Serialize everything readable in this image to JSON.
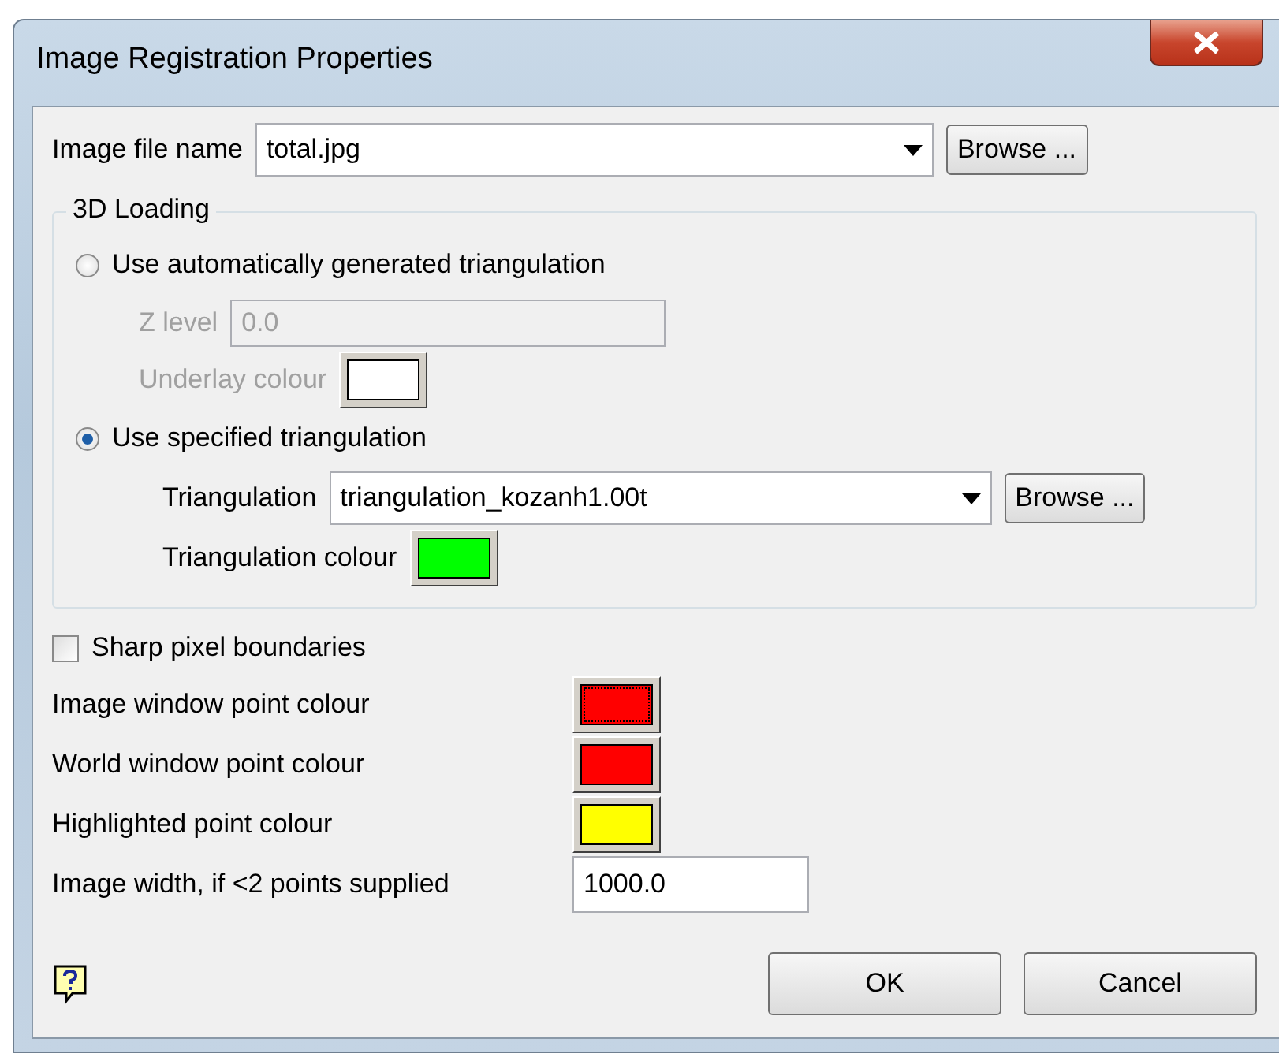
{
  "window": {
    "title": "Image Registration Properties"
  },
  "image_file": {
    "label": "Image file name",
    "value": "total.jpg",
    "button": "Browse ..."
  },
  "loading": {
    "title": "3D Loading",
    "options": [
      {
        "label": "Use automatically generated triangulation",
        "selected": false
      },
      {
        "label": "Use specified triangulation",
        "selected": true
      }
    ],
    "z_level": {
      "label": "Z level",
      "value": "0.0",
      "disabled": true
    },
    "underlay": {
      "label": "Underlay colour",
      "color": "#ffffff",
      "disabled": true
    },
    "triangulation": {
      "label": "Triangulation",
      "value": "triangulation_kozanh1.00t",
      "button": "Browse ..."
    },
    "triangulation_colour": {
      "label": "Triangulation colour",
      "color": "#00ff00"
    }
  },
  "sharp": {
    "label": "Sharp pixel boundaries",
    "checked": false
  },
  "colours": [
    {
      "label": "Image window point colour",
      "color": "#ff0000",
      "focused": true
    },
    {
      "label": "World window point colour",
      "color": "#ff0000",
      "focused": false
    },
    {
      "label": "Highlighted point colour",
      "color": "#ffff00",
      "focused": false
    }
  ],
  "image_width": {
    "label": "Image width, if <2 points supplied",
    "value": "1000.0"
  },
  "buttons": [
    "OK",
    "Cancel"
  ]
}
